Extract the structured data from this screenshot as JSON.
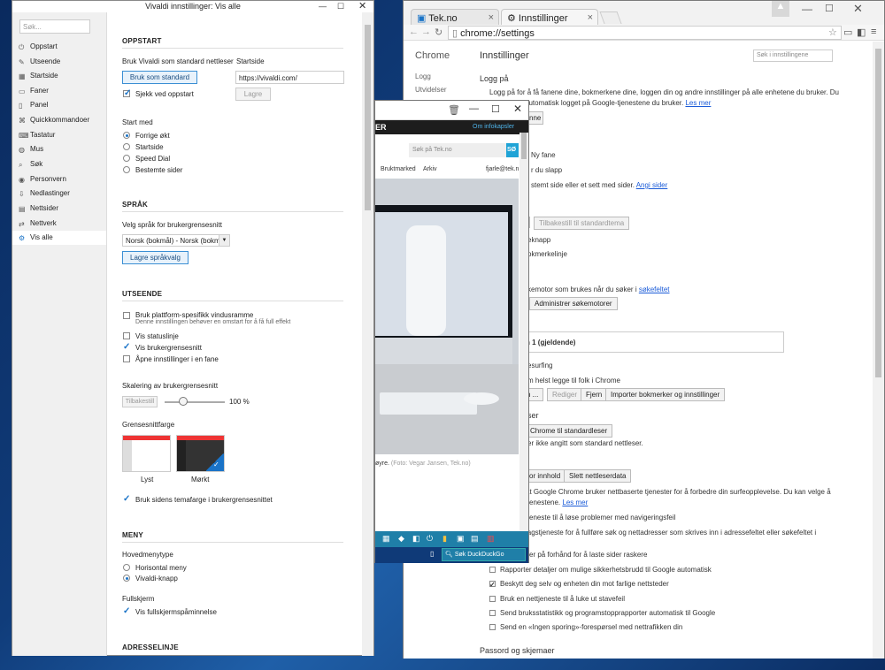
{
  "chrome": {
    "tabs": [
      {
        "label": "Tek.no"
      },
      {
        "label": "Innstillinger"
      }
    ],
    "address": "chrome://settings",
    "side_title": "Chrome",
    "side_items": [
      "Logg",
      "Utvidelser"
    ],
    "page_title": "Innstillinger",
    "search_placeholder": "Søk i innstillingene",
    "login_heading": "Logg på",
    "login_text1": "Logg på for å få fanene dine, bokmerkene dine, loggen din og andre innstillinger på alle enhetene du bruker. Du",
    "login_text2": "automatisk logget på Google-tjenestene du bruker.",
    "login_link": "Les mer",
    "btn_partial_name": "nne",
    "new_tab": "Ny fane",
    "left_off": "r du slapp",
    "set_pages": "stemt side eller et sett med sider.",
    "set_pages_link": "Angi sider",
    "reset_theme": "Tilbakestill til standardtema",
    "home_btn": "eknapp",
    "bookmarks_bar": "okmerkelinje",
    "search_engine_text": "kemotor som brukes når du søker i",
    "search_engine_link": "søkefeltet",
    "manage_engines": "Administrer søkemotorer",
    "person_label": "n 1 (gjeldende)",
    "guest": "esurfing",
    "guest2": "m helst legge til folk i Chrome",
    "btn_person": "n ...",
    "btn_edit": "Rediger",
    "btn_remove": "Fjern",
    "btn_import": "Importer bokmerker og innstillinger",
    "default_browser_heading": "ser",
    "make_default": "Chrome til standardleser",
    "not_default": "er ikke angitt som standard nettleser.",
    "content_btn": "or innhold",
    "clear_btn": "Slett nettleserdata",
    "privacy_text1": "at Google Chrome bruker nettbaserte tjenester for å forbedre din surfeopplevelse. Du kan velge å",
    "privacy_text2": "tjenestene.",
    "privacy_link": "Les mer",
    "opt1": "tjeneste til å løse problemer med navigeringsfeil",
    "opt2": "lagstjeneste for å fullføre søk og nettadresser som skrives inn i adressefeltet eller søkefeltet i",
    "opt3": "ser på forhånd for å laste sider raskere",
    "opt4": "Rapporter detaljer om mulige sikkerhetsbrudd til Google automatisk",
    "opt5": "Beskytt deg selv og enheten din mot farlige nettsteder",
    "opt6": "Bruk en nettjeneste til å luke ut stavefeil",
    "opt7": "Send bruksstatistikk og programstopprapporter automatisk til Google",
    "opt8": "Send en «Ingen sporing»-forespørsel med nettrafikken din",
    "passwords": "Passord og skjemaer"
  },
  "vivaldi": {
    "title": "Vivaldi innstillinger: Vis alle",
    "search_placeholder": "Søk...",
    "sidebar": [
      {
        "label": "Oppstart",
        "icon": "startup-icon"
      },
      {
        "label": "Utseende",
        "icon": "appearance-icon"
      },
      {
        "label": "Startside",
        "icon": "startpage-icon"
      },
      {
        "label": "Faner",
        "icon": "tabs-icon"
      },
      {
        "label": "Panel",
        "icon": "panel-icon"
      },
      {
        "label": "Quickkommandoer",
        "icon": "quick-commands-icon"
      },
      {
        "label": "Tastatur",
        "icon": "keyboard-icon"
      },
      {
        "label": "Mus",
        "icon": "mouse-icon"
      },
      {
        "label": "Søk",
        "icon": "search-icon"
      },
      {
        "label": "Personvern",
        "icon": "privacy-icon"
      },
      {
        "label": "Nedlastinger",
        "icon": "downloads-icon"
      },
      {
        "label": "Nettsider",
        "icon": "webpages-icon"
      },
      {
        "label": "Nettverk",
        "icon": "network-icon"
      },
      {
        "label": "Vis alle",
        "icon": "gear-icon"
      }
    ],
    "startup": {
      "heading": "OPPSTART",
      "default_browser_label": "Bruk Vivaldi som standard nettleser",
      "default_btn": "Bruk som standard",
      "check_startup": "Sjekk ved oppstart",
      "homepage_label": "Startside",
      "homepage_value": "https://vivaldi.com/",
      "save_btn": "Lagre",
      "start_with": "Start med",
      "options": [
        "Forrige økt",
        "Startside",
        "Speed Dial",
        "Bestemte sider"
      ]
    },
    "language": {
      "heading": "SPRÅK",
      "label": "Velg språk for brukergrensesnitt",
      "value": "Norsk (bokmål) - Norsk (bokm",
      "save_btn": "Lagre språkvalg"
    },
    "appearance": {
      "heading": "UTSEENDE",
      "platform_frame": "Bruk plattform-spesifikk vindusramme",
      "platform_note": "Denne innstillingen behøver en omstart for å få full effekt",
      "statusbar": "Vis statuslinje",
      "ui": "Vis brukergrensesnitt",
      "open_in_tab": "Åpne innstillinger i en fane",
      "scale_label": "Skalering av brukergrensesnitt",
      "reset_btn": "Tilbakestill",
      "scale_value": "100 %",
      "ui_scale": 1.0,
      "color_label": "Grensesnittfarge",
      "theme_light": "Lyst",
      "theme_dark": "Mørkt",
      "page_color": "Bruk sidens temafarge i brukergrensesnittet"
    },
    "menu": {
      "heading": "MENY",
      "type_label": "Hovedmenytype",
      "opt_horizontal": "Horisontal meny",
      "opt_button": "Vivaldi-knapp",
      "fullscreen_label": "Fullskjerm",
      "fullscreen_reminder": "Vis fullskjermspåminnelse"
    },
    "address_heading": "ADRESSELINJE"
  },
  "tek": {
    "header_text": "ER",
    "cookie_link": "Om infokapsler",
    "search_placeholder": "Søk på Tek.no",
    "search_btn": "SØ",
    "nav": [
      "Bruktmarked",
      "Arkiv"
    ],
    "user": "fjarle@tek.n",
    "caption": "øyre.",
    "credit": "(Foto: Vegar Jansen, Tek.no)",
    "taskbar_search": "Søk DuckDuckGo"
  }
}
